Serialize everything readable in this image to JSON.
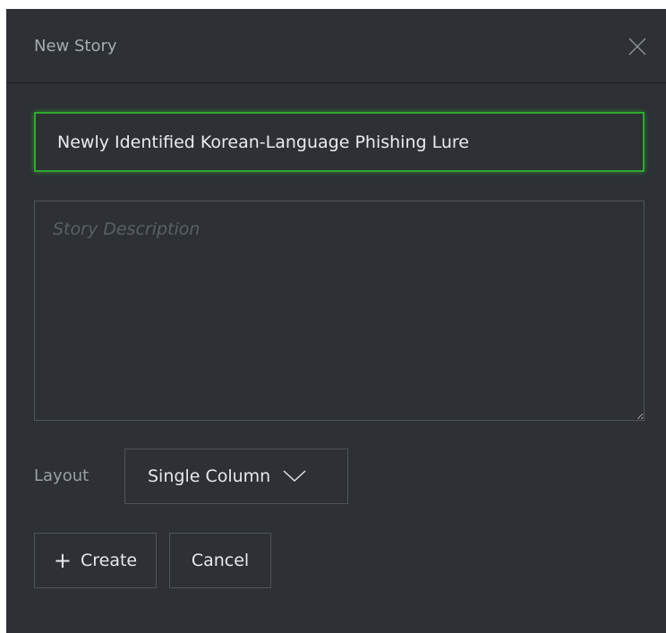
{
  "dialog": {
    "title": "New Story",
    "close_icon": "close-icon"
  },
  "form": {
    "title_value": "Newly Identified Korean-Language Phishing Lure",
    "description_value": "",
    "description_placeholder": "Story Description",
    "layout_label": "Layout",
    "layout_selected": "Single Column"
  },
  "actions": {
    "create_icon": "+",
    "create_label": "Create",
    "cancel_label": "Cancel"
  },
  "colors": {
    "background": "#2d3034",
    "focus_border": "#2fa82f",
    "text": "#e9ecef",
    "muted_text": "#a6abb1"
  }
}
